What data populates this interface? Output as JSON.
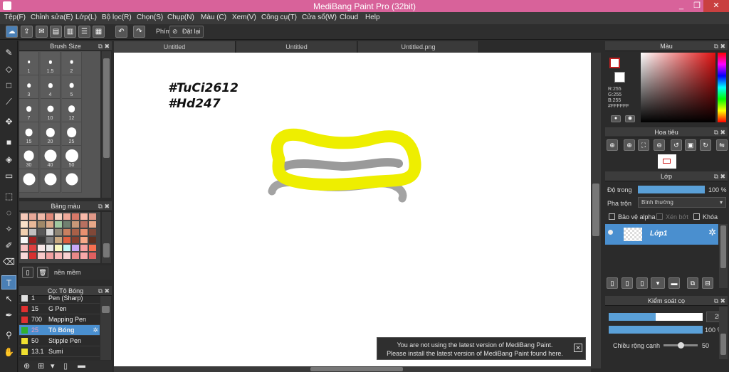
{
  "app": {
    "title": "MediBang Paint Pro (32bit)"
  },
  "window_controls": {
    "minimize": "_",
    "restore": "❐",
    "close": "✕"
  },
  "menu": [
    "Tệp(F)",
    "Chỉnh sửa(E)",
    "Lớp(L)",
    "Bộ lọc(R)",
    "Chọn(S)",
    "Chụp(N)",
    "Màu (C)",
    "Xem(V)",
    "Công cụ(T)",
    "Cửa sổ(W)",
    "Cloud",
    "Help"
  ],
  "toolbar": {
    "phim_label": "Phím",
    "reset_label": "Đặt lại"
  },
  "brush_size_panel": {
    "title": "Brush Size",
    "sizes": [
      "1",
      "1.5",
      "2",
      "3",
      "4",
      "5",
      "7",
      "10",
      "12",
      "15",
      "20",
      "25",
      "30",
      "40",
      "50",
      "",
      "",
      ""
    ]
  },
  "palette_panel": {
    "title": "Bảng màu",
    "colors": [
      "#f5c8b8",
      "#e8a898",
      "#f0b8a8",
      "#e08878",
      "#f8d0c0",
      "#f0a898",
      "#d87868",
      "#f8b8a8",
      "#e09888",
      "#f8e0c8",
      "#e8b898",
      "#a08868",
      "#d8a888",
      "#a0c8a0",
      "#708070",
      "#c89878",
      "#b87060",
      "#e8a888",
      "#f0d0b0",
      "#c0c0c0",
      "#585858",
      "#d8d8d8",
      "#908878",
      "#c88060",
      "#a86048",
      "#e89070",
      "#804838",
      "#f8f8f8",
      "#a02020",
      "#383838",
      "#808080",
      "#c8a880",
      "#e06040",
      "#884030",
      "#f8a888",
      "#603020",
      "#f8c0c0",
      "#e04040",
      "#f8e8e8",
      "#e8e8e8",
      "#f8f8c0",
      "#c0f8f8",
      "#c8a8f8",
      "#f8a0a0",
      "#f87050",
      "#f8d8d8",
      "#d83030",
      "#f8c8c8",
      "#f0a0a0",
      "#f8b8b8",
      "#f8d0d0",
      "#e88888",
      "#f8a8a8",
      "#e06060"
    ],
    "footer_label": "nền mềm"
  },
  "brush_list_panel": {
    "title": "Cọ: Tô Bóng",
    "items": [
      {
        "color": "#e0e0e0",
        "size": "1",
        "name": "Pen (Sharp)",
        "selected": false
      },
      {
        "color": "#e03030",
        "size": "15",
        "name": "G Pen",
        "selected": false
      },
      {
        "color": "#e03030",
        "size": "700",
        "name": "Mapping Pen",
        "selected": false
      },
      {
        "color": "#30b030",
        "size": "25",
        "name": "Tô Bóng",
        "selected": true
      },
      {
        "color": "#f0e030",
        "size": "50",
        "name": "Stipple Pen",
        "selected": false
      },
      {
        "color": "#f0e030",
        "size": "13.1",
        "name": "Sumi",
        "selected": false
      }
    ]
  },
  "tabs": [
    "Untitled",
    "Untitled",
    "Untitled.png"
  ],
  "canvas": {
    "text_line1": "#TuCi2612",
    "text_line2": "#Hd247"
  },
  "notification": {
    "line1": "You are not using the latest version of MediBang Paint.",
    "line2": "Please install the latest version of MediBang Paint found here.",
    "close": "✕"
  },
  "color_panel": {
    "title": "Màu",
    "r": "R:255",
    "g": "G:255",
    "b": "B:255",
    "hex": "#FFFFFF"
  },
  "navigator_panel": {
    "title": "Hoa tiêu"
  },
  "layer_panel": {
    "title": "Lớp",
    "opacity_label": "Độ trong",
    "opacity_value": "100 %",
    "opacity_fraction": 1.0,
    "blend_label": "Pha trộn",
    "blend_value": "Bình thường",
    "protect_alpha": "Bảo vệ alpha",
    "clipping": "Xén bớt",
    "lock": "Khóa",
    "layers": [
      {
        "name": "Lớp1"
      }
    ]
  },
  "brush_control_panel": {
    "title": "Kiểm soát cọ",
    "size_value": "25",
    "size_fraction": 0.5,
    "opacity_value": "100 %",
    "opacity_fraction": 1.0,
    "edge_label": "Chiều rộng cạnh",
    "edge_value": "50",
    "edge_fraction": 0.5
  },
  "colors": {
    "titlebar": "#d8629a",
    "accent": "#4a8fcf",
    "yellow_stroke": "#f0ee00",
    "gray_stroke": "#a0a0a0"
  }
}
